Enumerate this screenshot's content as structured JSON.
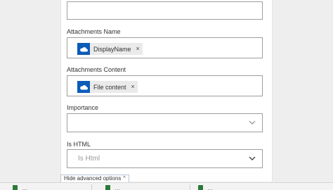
{
  "form": {
    "attachments_name": {
      "label": "Attachments Name",
      "token": {
        "label": "DisplayName",
        "icon": "onedrive-cloud-icon",
        "remove": "×"
      }
    },
    "attachments_content": {
      "label": "Attachments Content",
      "token": {
        "label": "File content",
        "icon": "onedrive-cloud-icon",
        "remove": "×"
      }
    },
    "importance": {
      "label": "Importance",
      "value": ""
    },
    "is_html": {
      "label": "Is HTML",
      "placeholder": "Is Html"
    },
    "advanced_toggle": {
      "label": "Hide advanced options",
      "caret": "^"
    }
  },
  "bottom_steps": [
    {
      "label": "…",
      "icon": "excel-icon"
    },
    {
      "label": "…",
      "icon": "excel-icon"
    },
    {
      "label": "…",
      "icon": "excel-icon"
    }
  ],
  "colors": {
    "token_icon_bg": "#0a5cb8",
    "token_bg": "#eaeaea",
    "border": "#9e9e9e",
    "placeholder": "#999999"
  }
}
